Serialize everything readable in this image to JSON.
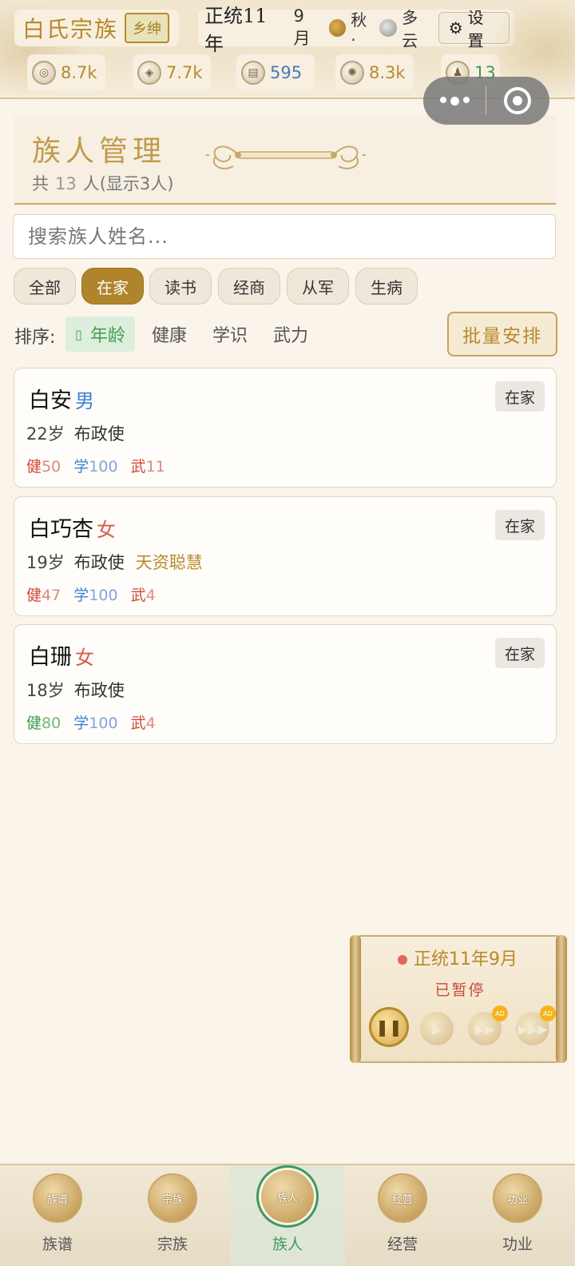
{
  "header": {
    "clan_name": "白氏宗族",
    "rank": "乡绅",
    "era": "正统11年",
    "month": "9月",
    "season": "秋·",
    "weather": "多云",
    "settings_label": "设置",
    "resources": [
      {
        "icon": "silver-icon",
        "value": "8.7k"
      },
      {
        "icon": "money-bag-icon",
        "value": "7.7k"
      },
      {
        "icon": "cloth-icon",
        "value": "595"
      },
      {
        "icon": "grain-icon",
        "value": "8.3k"
      },
      {
        "icon": "family-icon",
        "value": "13"
      }
    ]
  },
  "title_panel": {
    "title": "族人管理",
    "count_prefix": "共",
    "count": "13",
    "count_suffix": "人(显示3人)"
  },
  "search": {
    "placeholder": "搜索族人姓名..."
  },
  "filter_tabs": [
    "全部",
    "在家",
    "读书",
    "经商",
    "从军",
    "生病"
  ],
  "active_tab": "在家",
  "sort": {
    "label": "排序:",
    "check_glyph": "▯",
    "options": [
      "年龄",
      "健康",
      "学识",
      "武力"
    ],
    "active": "年龄",
    "batch_label": "批量安排"
  },
  "members": [
    {
      "name": "白安",
      "gender": "男",
      "status": "在家",
      "age": "22岁",
      "title": "布政使",
      "trait": "",
      "health_label": "健",
      "health": "50",
      "study_label": "学",
      "study": "100",
      "martial_label": "武",
      "martial": "11"
    },
    {
      "name": "白巧杏",
      "gender": "女",
      "status": "在家",
      "age": "19岁",
      "title": "布政使",
      "trait": "天资聪慧",
      "health_label": "健",
      "health": "47",
      "study_label": "学",
      "study": "100",
      "martial_label": "武",
      "martial": "4"
    },
    {
      "name": "白珊",
      "gender": "女",
      "status": "在家",
      "age": "18岁",
      "title": "布政使",
      "trait": "",
      "health_label": "健",
      "health": "80",
      "study_label": "学",
      "study": "100",
      "martial_label": "武",
      "martial": "4"
    }
  ],
  "time_control": {
    "date": "正统11年9月",
    "status": "已暂停",
    "ad_label": "AD"
  },
  "bottom_nav": [
    {
      "icon_text": "族谱",
      "label": "族谱"
    },
    {
      "icon_text": "宗族",
      "label": "宗族"
    },
    {
      "icon_text": "族人",
      "label": "族人"
    },
    {
      "icon_text": "经营",
      "label": "经营"
    },
    {
      "icon_text": "功业",
      "label": "功业"
    }
  ],
  "active_nav": "族人",
  "colors": {
    "gold": "#b8892e",
    "active_tab": "#b0842b",
    "green": "#3b9a62",
    "red": "#d0473b",
    "blue": "#3d7fd8"
  }
}
